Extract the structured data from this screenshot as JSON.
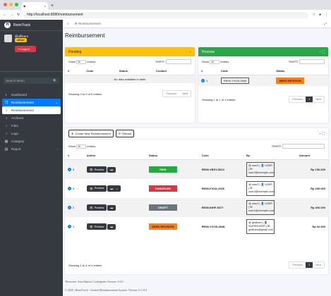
{
  "browser": {
    "tab_title": "",
    "url": "http://localhost:8080/reimbursement"
  },
  "colors": {
    "pending": "#ffc107",
    "process": "#28a745",
    "paid": "#28a745",
    "canceled": "#dc3545",
    "draft": "#6c757d",
    "need_revision": "#fd7e14"
  },
  "sidebar": {
    "brand": "ReimTrack",
    "user_name": "@officer1",
    "user_badge": "officer",
    "logout": "Logout",
    "search_placeholder": "Search Menu",
    "items": [
      {
        "label": "Dashboard",
        "icon": "palette-icon"
      },
      {
        "label": "Reimbursement",
        "icon": "copy-icon"
      },
      {
        "label": "Reimbursement",
        "icon": "circle-icon"
      },
      {
        "label": "Archives",
        "icon": "circle-icon"
      },
      {
        "label": "Files",
        "icon": "circle-icon"
      },
      {
        "label": "Logs",
        "icon": "circle-icon"
      },
      {
        "label": "Category",
        "icon": "grid-icon"
      },
      {
        "label": "Report",
        "icon": "chart-icon"
      }
    ]
  },
  "topnav": {
    "breadcrumb": "Reimbursement"
  },
  "page": {
    "title": "Reimbursement"
  },
  "pending": {
    "title": "Pending",
    "show": "Show",
    "entries": "entries",
    "length": "10",
    "search": "Search:",
    "cols": [
      "#",
      "Code",
      "Status",
      "Created"
    ],
    "empty": "No data available in table",
    "info": "Showing 0 to 0 of 0 entries",
    "prev": "Previous",
    "next": "Next"
  },
  "process": {
    "title": "Process",
    "show": "Show",
    "entries": "entries",
    "length": "10",
    "search": "Search:",
    "cols": [
      "#",
      "Code",
      "Status"
    ],
    "row": {
      "no": "1",
      "code": "REIM-YXCB-2848",
      "status": "NEED REVISION"
    },
    "info": "Showing 1 to 1 of 1 entries",
    "prev": "Previous",
    "page": "1",
    "next": "Next"
  },
  "main": {
    "create_btn": "Create New Reimbursement",
    "reload_btn": "Reload",
    "show": "Show",
    "entries": "entries",
    "length": "10",
    "search": "Search:",
    "cols": [
      "#",
      "Action",
      "Status",
      "Code",
      "By",
      "Amount"
    ],
    "preview": "Preview",
    "rows": [
      {
        "no": "4",
        "status": "PAID",
        "code": "REIM-VBSV-5610",
        "by1": "@ user2 | 👤 USER | ✉",
        "by2": "user2@example.com",
        "amount": "Rp 150.000"
      },
      {
        "no": "3",
        "status": "CANCELED",
        "code": "REIM-FXXA-2926",
        "by1": "@ user2 | 👤 USER | ✉",
        "by2": "user2@example.com",
        "amount": "Rp 200.000"
      },
      {
        "no": "2",
        "status": "DRAFT",
        "code": "REIM-INHF-5377",
        "by1": "@ user1 | 👤 USER | ✉",
        "by2": "user1@example.com",
        "amount": "Rp 300.000"
      },
      {
        "no": "1",
        "status": "NEED REVISION",
        "code": "REIM-YXCB-2848",
        "by1": "@ gridtutor | 👤 SUPERUSER | ✉",
        "by2": "gridtutor@gmail.com",
        "amount": "Rp 32.000"
      }
    ],
    "info": "Showing 1 to 4 of 4 entries",
    "prev": "Previous",
    "page": "1",
    "next": "Next"
  },
  "footer": {
    "timezone": "Timezone: Asia/Jakarta | Codeigniter Version: 4.6.0",
    "copyright": "© 2025 | ReimTrack - General Reimbursement System. Version: G.1.0.0"
  }
}
